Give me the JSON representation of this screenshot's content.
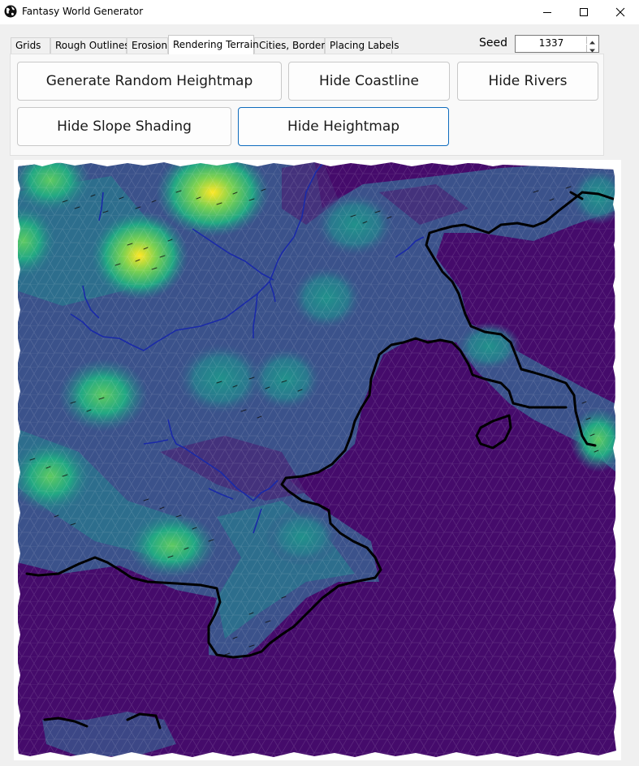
{
  "window": {
    "title": "Fantasy World Generator"
  },
  "tabs": [
    {
      "label": "Grids"
    },
    {
      "label": "Rough Outlines"
    },
    {
      "label": "Erosion"
    },
    {
      "label": "Rendering Terrain"
    },
    {
      "label": "Cities, Borders"
    },
    {
      "label": "Placing Labels"
    }
  ],
  "active_tab": "Rendering Terrain",
  "seed": {
    "label": "Seed",
    "value": "1337"
  },
  "buttons": {
    "generate": "Generate Random Heightmap",
    "coastline": "Hide Coastline",
    "rivers": "Hide Rivers",
    "slope": "Hide Slope Shading",
    "heightmap": "Hide Heightmap"
  },
  "colors": {
    "sea": "#440a68",
    "low_land": "#3b528b",
    "mid_land": "#21918c",
    "high_land": "#5ec962",
    "peak": "#fde725",
    "river": "#1a2aa8",
    "coastline": "#000000",
    "focus_border": "#0f6cbd"
  },
  "icons": {
    "app": "globe-icon",
    "minimize": "minimize-icon",
    "maximize": "maximize-icon",
    "close": "close-icon",
    "spin_up": "spin-up-icon",
    "spin_down": "spin-down-icon"
  }
}
